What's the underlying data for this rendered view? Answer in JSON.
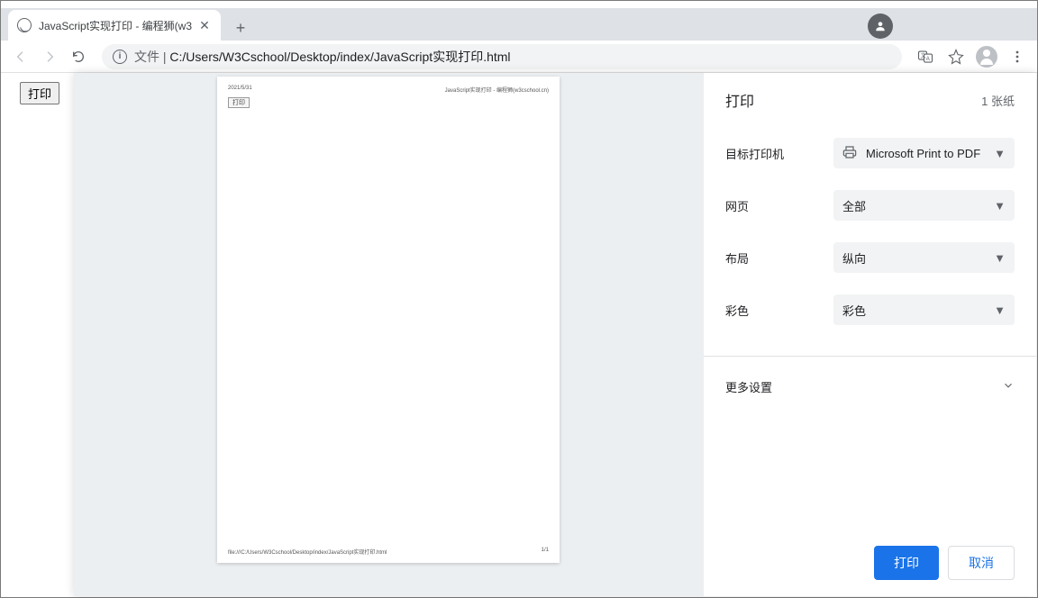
{
  "window": {
    "tab_title": "JavaScript实现打印 - 编程狮(w3",
    "url_prefix": "文件",
    "url_separator": " | ",
    "url_path": "C:/Users/W3Cschool/Desktop/index/JavaScript实现打印.html"
  },
  "underlying_page": {
    "print_button": "打印"
  },
  "preview": {
    "date": "2021/5/31",
    "page_title": "JavaScript实现打印 - 编程狮(w3cschool.cn)",
    "mini_button": "打印",
    "footer_url": "file:///C:/Users/W3Cschool/Desktop/index/JavaScript实现打印.html",
    "page_num": "1/1"
  },
  "print_dialog": {
    "title": "打印",
    "sheet_count": "1 张纸",
    "rows": {
      "destination": {
        "label": "目标打印机",
        "value": "Microsoft Print to PDF"
      },
      "pages": {
        "label": "网页",
        "value": "全部"
      },
      "layout": {
        "label": "布局",
        "value": "纵向"
      },
      "color": {
        "label": "彩色",
        "value": "彩色"
      }
    },
    "more_settings": "更多设置",
    "actions": {
      "print": "打印",
      "cancel": "取消"
    }
  }
}
